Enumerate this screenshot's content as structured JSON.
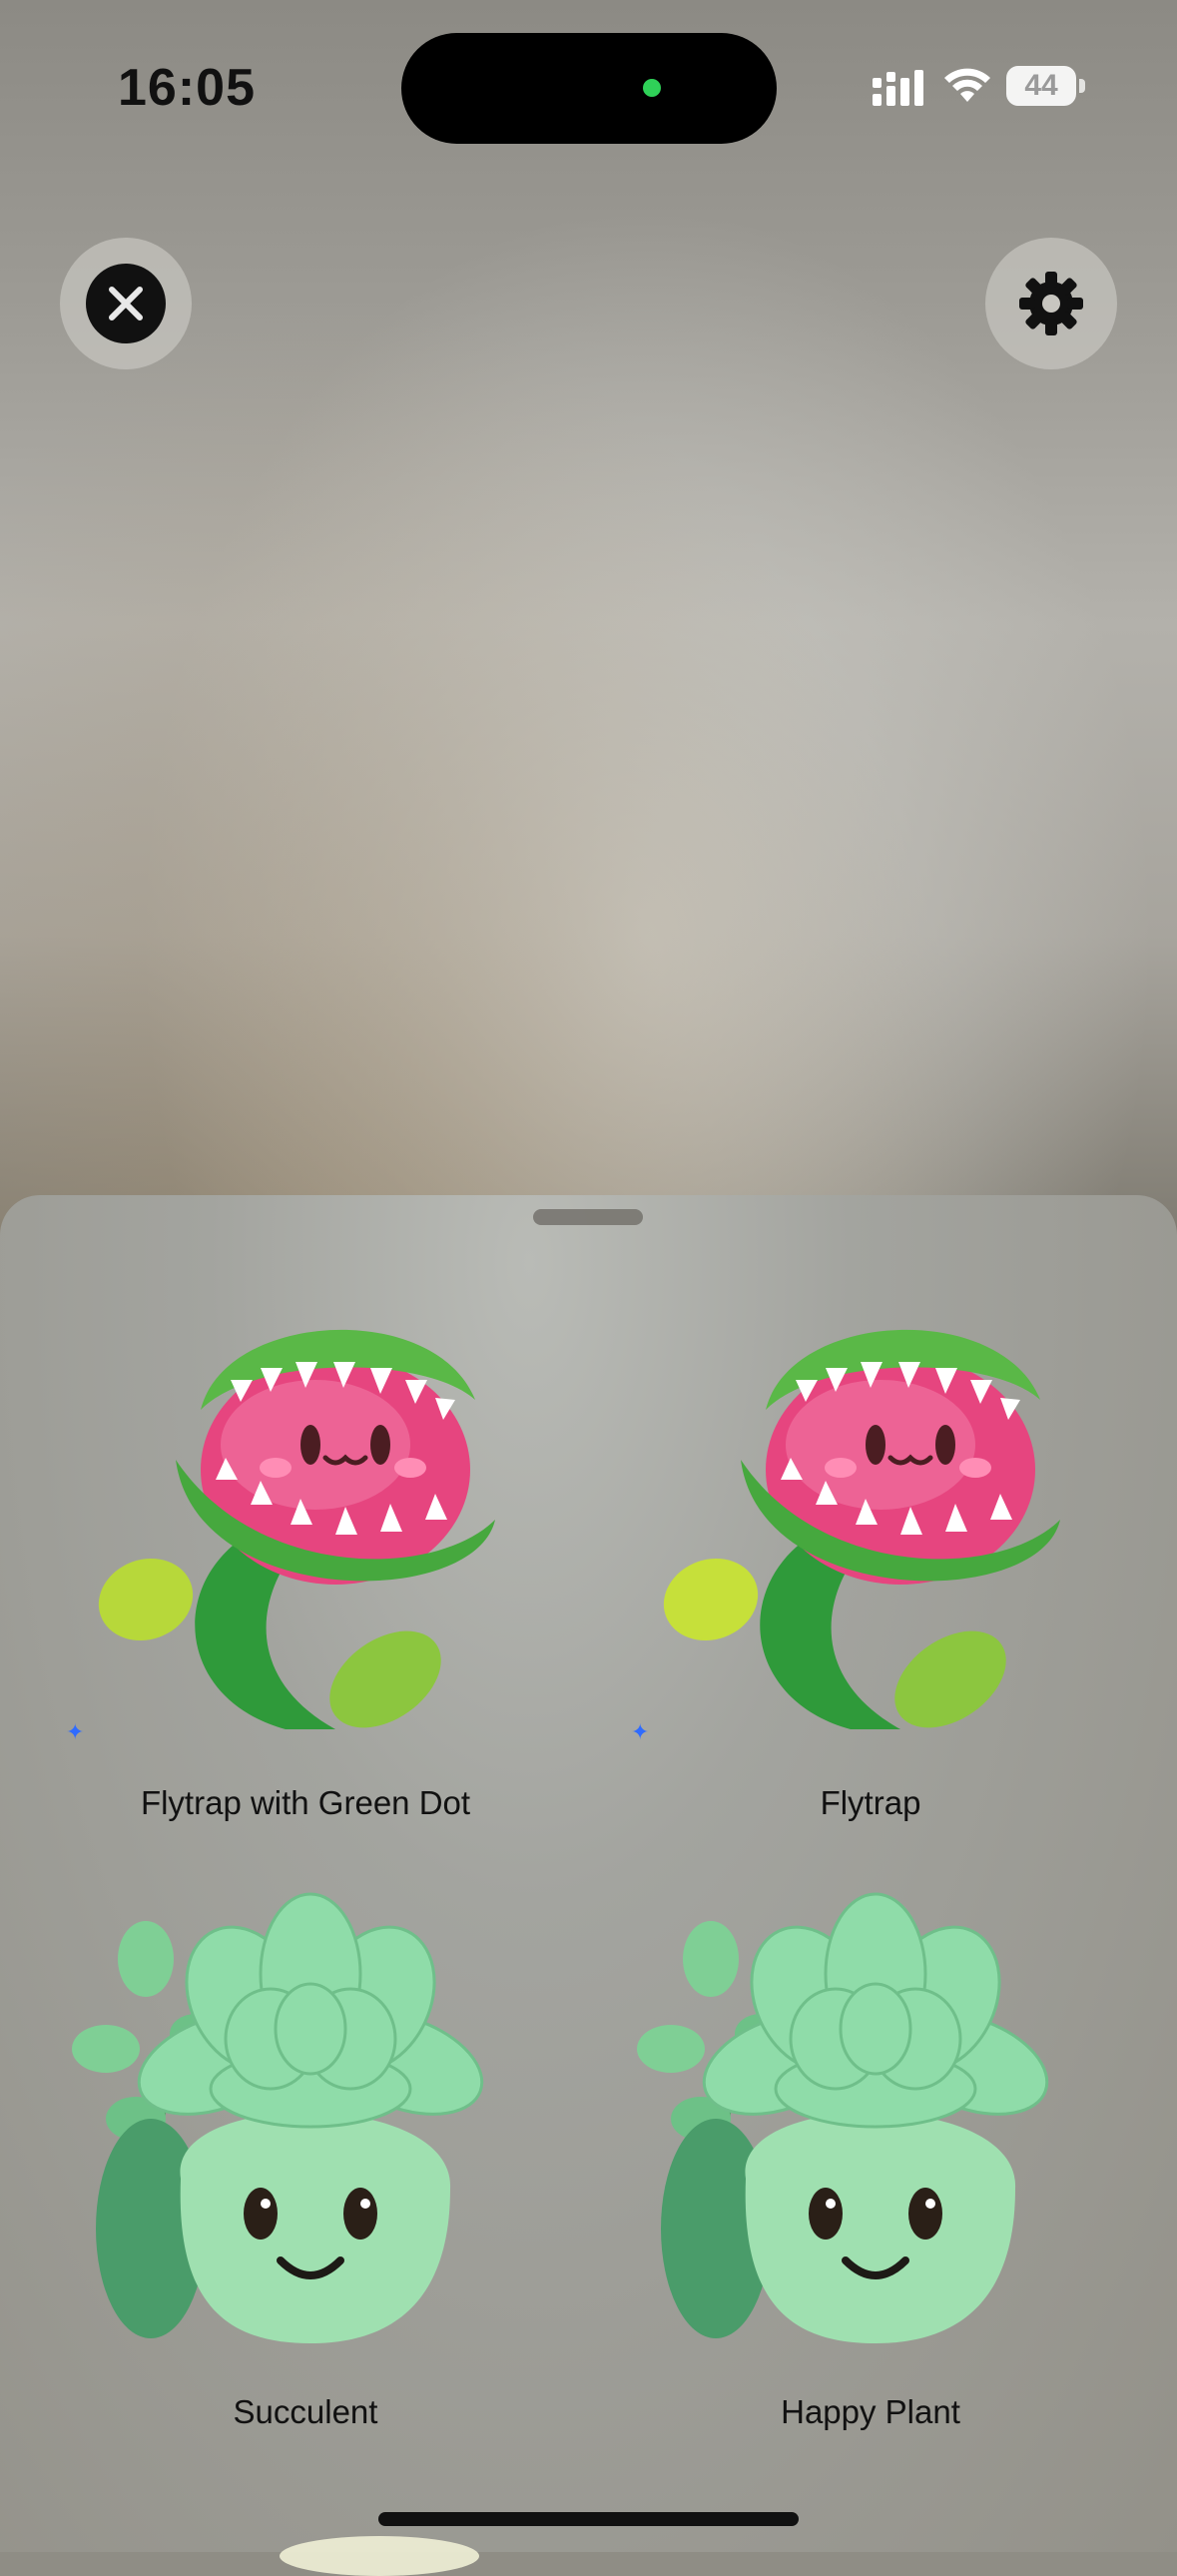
{
  "status_bar": {
    "time": "16:05",
    "battery": "44"
  },
  "toolbar": {
    "close_icon": "close-icon",
    "settings_icon": "gear-icon"
  },
  "stickers": [
    {
      "label": "Flytrap with Green Dot",
      "art": "flytrap-icon"
    },
    {
      "label": "Flytrap",
      "art": "flytrap-icon"
    },
    {
      "label": "Succulent",
      "art": "succulent-icon"
    },
    {
      "label": "Happy Plant",
      "art": "succulent-icon"
    }
  ],
  "colors": {
    "accent_green": "#2fd158",
    "sparkle_blue": "#2f6bff"
  }
}
